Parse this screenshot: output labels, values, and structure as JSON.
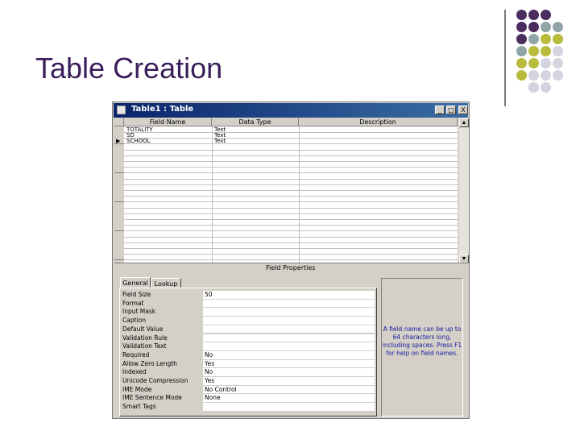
{
  "slide": {
    "title": "Table Creation"
  },
  "dot_colors": {
    "purple": "#4b2c5e",
    "teal": "#8fa5a8",
    "olive": "#b9bb3c",
    "gray": "#d3d4e0"
  },
  "window": {
    "title": "Table1 : Table",
    "buttons": {
      "minimize": "_",
      "maximize": "□",
      "close": "X"
    }
  },
  "grid": {
    "headers": {
      "field_name": "Field Name",
      "data_type": "Data Type",
      "description": "Description"
    },
    "rows": [
      {
        "field_name": "TOTALITY",
        "data_type": "Text",
        "description": ""
      },
      {
        "field_name": "SD",
        "data_type": "Text",
        "description": ""
      },
      {
        "field_name": "SCHOOL",
        "data_type": "Text",
        "description": ""
      }
    ],
    "current_row_marker": "▶"
  },
  "field_properties_label": "Field Properties",
  "tabs": {
    "general": "General",
    "lookup": "Lookup"
  },
  "properties": [
    {
      "label": "Field Size",
      "value": "50"
    },
    {
      "label": "Format",
      "value": ""
    },
    {
      "label": "Input Mask",
      "value": ""
    },
    {
      "label": "Caption",
      "value": ""
    },
    {
      "label": "Default Value",
      "value": ""
    },
    {
      "label": "Validation Rule",
      "value": ""
    },
    {
      "label": "Validation Text",
      "value": ""
    },
    {
      "label": "Required",
      "value": "No"
    },
    {
      "label": "Allow Zero Length",
      "value": "Yes"
    },
    {
      "label": "Indexed",
      "value": "No"
    },
    {
      "label": "Unicode Compression",
      "value": "Yes"
    },
    {
      "label": "IME Mode",
      "value": "No Control"
    },
    {
      "label": "IME Sentence Mode",
      "value": "None"
    },
    {
      "label": "Smart Tags",
      "value": ""
    }
  ],
  "help_text": "A field name can be up to 64 characters long, including spaces. Press F1 for help on field names."
}
